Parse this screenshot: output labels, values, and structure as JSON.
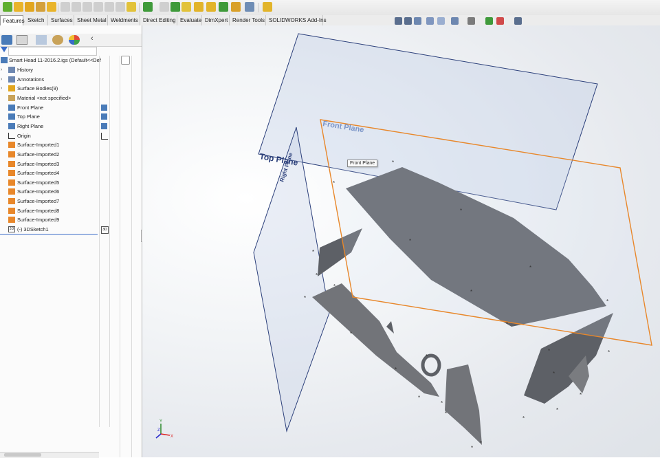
{
  "tabs": [
    "Features",
    "Sketch",
    "Surfaces",
    "Sheet Metal",
    "Weldments",
    "Direct Editing",
    "Evaluate",
    "DimXpert",
    "Render Tools",
    "SOLIDWORKS Add-Ins"
  ],
  "active_tab": "Features",
  "tree": {
    "root": "Smart Head 11-2016.2.igs  (Default<<Def",
    "items": [
      {
        "label": "History",
        "icon": "history-icon"
      },
      {
        "label": "Annotations",
        "icon": "annotations-icon"
      },
      {
        "label": "Surface Bodies(9)",
        "icon": "surface-bodies-icon"
      },
      {
        "label": "Material <not specified>",
        "icon": "material-icon"
      },
      {
        "label": "Front Plane",
        "icon": "plane-icon"
      },
      {
        "label": "Top Plane",
        "icon": "plane-icon"
      },
      {
        "label": "Right Plane",
        "icon": "plane-icon"
      },
      {
        "label": "Origin",
        "icon": "origin-icon"
      },
      {
        "label": "Surface-Imported1",
        "icon": "surface-imported-icon"
      },
      {
        "label": "Surface-Imported2",
        "icon": "surface-imported-icon"
      },
      {
        "label": "Surface-Imported3",
        "icon": "surface-imported-icon"
      },
      {
        "label": "Surface-Imported4",
        "icon": "surface-imported-icon"
      },
      {
        "label": "Surface-Imported5",
        "icon": "surface-imported-icon"
      },
      {
        "label": "Surface-Imported6",
        "icon": "surface-imported-icon"
      },
      {
        "label": "Surface-Imported7",
        "icon": "surface-imported-icon"
      },
      {
        "label": "Surface-Imported8",
        "icon": "surface-imported-icon"
      },
      {
        "label": "Surface-Imported9",
        "icon": "surface-imported-icon"
      },
      {
        "label": "(-) 3DSketch1",
        "icon": "3dsketch-icon"
      }
    ],
    "col_badge": "3D"
  },
  "viewport": {
    "plane_labels": {
      "front": "Front Plane",
      "top": "Top Plane",
      "right": "Right Plane"
    },
    "tooltip": "Front Plane",
    "triad": {
      "x": "X",
      "y": "Y",
      "z": "Z"
    }
  },
  "colors": {
    "accent": "#e8872a",
    "plane_edge": "#2b3f7a",
    "surface": "#5d6066",
    "tab_bg": "#ececec"
  }
}
